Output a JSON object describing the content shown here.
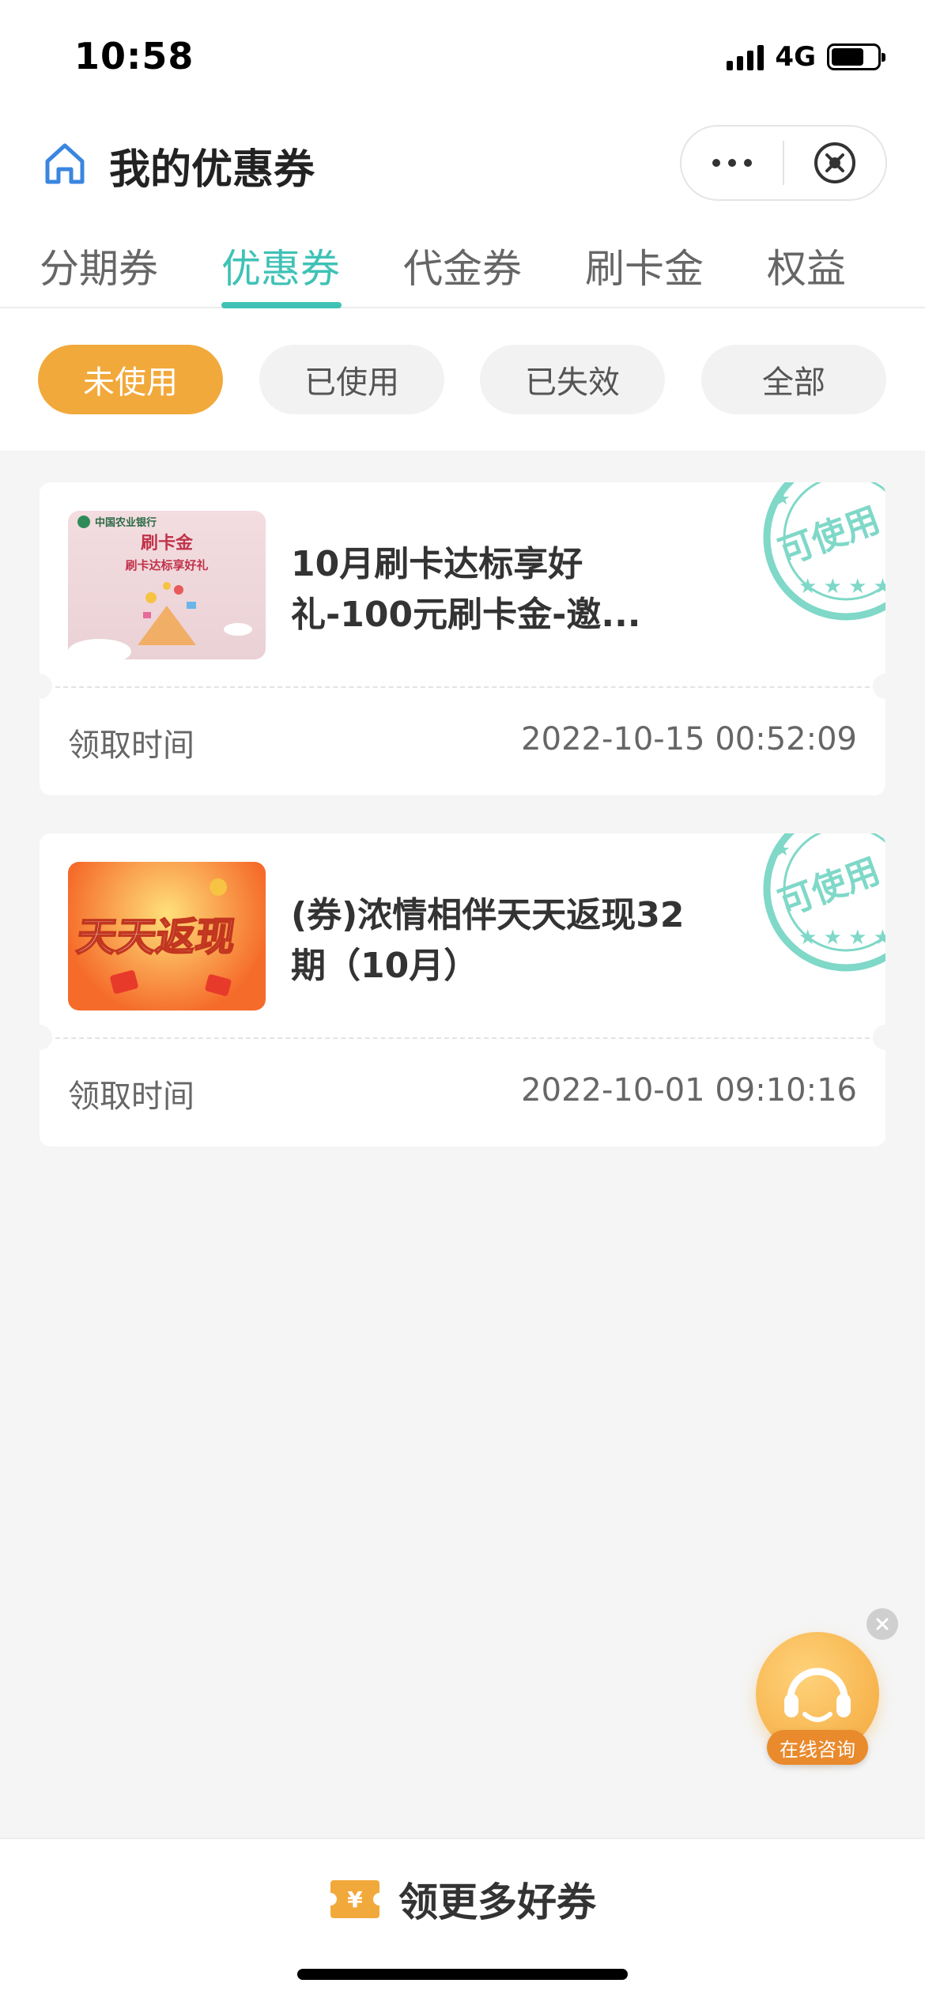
{
  "status_bar": {
    "time": "10:58",
    "network": "4G",
    "battery_level": 0.72
  },
  "header": {
    "title": "我的优惠券"
  },
  "tabs": [
    {
      "label": "分期券",
      "active": false
    },
    {
      "label": "优惠券",
      "active": true
    },
    {
      "label": "代金券",
      "active": false
    },
    {
      "label": "刷卡金",
      "active": false
    },
    {
      "label": "权益",
      "active": false
    }
  ],
  "filters": [
    {
      "label": "未使用",
      "active": true
    },
    {
      "label": "已使用",
      "active": false
    },
    {
      "label": "已失效",
      "active": false
    },
    {
      "label": "全部",
      "active": false
    }
  ],
  "coupons": [
    {
      "title": "10月刷卡达标享好礼-100元刷卡金-邀...",
      "stamp": "可使用",
      "thumb": {
        "bank": "中国农业银行",
        "line1": "刷卡金",
        "line2": "刷卡达标享好礼"
      },
      "time_label": "领取时间",
      "time_value": "2022-10-15 00:52:09"
    },
    {
      "title": "(券)浓情相伴天天返现32期（10月）",
      "stamp": "可使用",
      "thumb": {
        "line1": "天天返现"
      },
      "time_label": "领取时间",
      "time_value": "2022-10-01 09:10:16"
    }
  ],
  "float_service": {
    "label": "在线咨询"
  },
  "bottom": {
    "label": "领更多好券",
    "ticket_symbol": "¥"
  },
  "colors": {
    "accent": "#3fc2b5",
    "chip_active": "#f2a93b",
    "stamp": "#7fd8c8"
  }
}
